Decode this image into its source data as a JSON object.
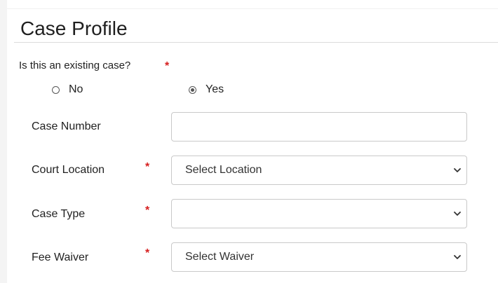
{
  "section": {
    "title": "Case Profile"
  },
  "existing_case": {
    "question": "Is this an existing case?",
    "required_mark": "*",
    "options": [
      {
        "label": "No",
        "selected": false
      },
      {
        "label": "Yes",
        "selected": true
      }
    ]
  },
  "fields": {
    "case_number": {
      "label": "Case Number",
      "value": "",
      "required": false
    },
    "court_location": {
      "label": "Court Location",
      "required_mark": "*",
      "selected": "Select Location",
      "icon": "chevron-down-icon"
    },
    "case_type": {
      "label": "Case Type",
      "required_mark": "*",
      "selected": "",
      "icon": "chevron-down-icon"
    },
    "fee_waiver": {
      "label": "Fee Waiver",
      "required_mark": "*",
      "selected": "Select Waiver",
      "icon": "chevron-down-icon"
    }
  },
  "colors": {
    "required": "#d61f1f",
    "border": "#c9c9c9",
    "text": "#222222"
  }
}
